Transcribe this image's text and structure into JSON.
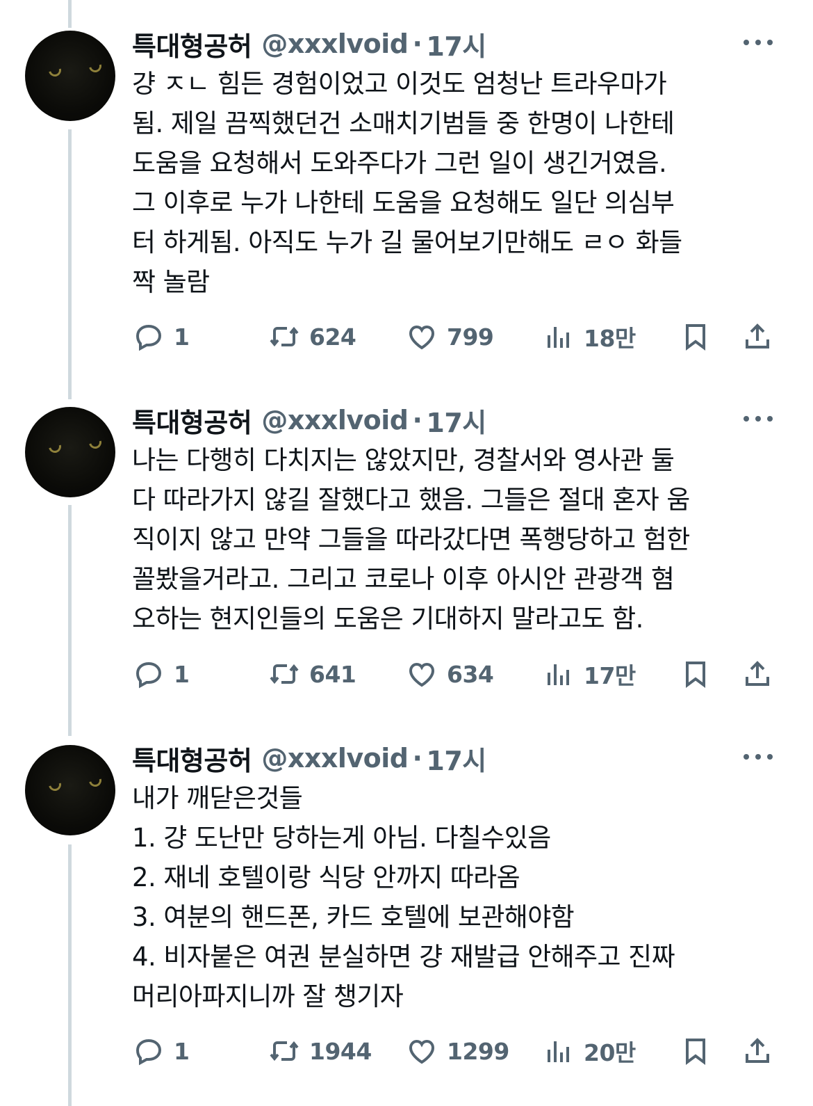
{
  "tweets": [
    {
      "name": "특대형공허",
      "handle": "@xxxlvoid",
      "separator": "·",
      "time": "17시",
      "lines": [
        "걍 ㅈㄴ 힘든 경험이었고 이것도 엄청난 트라우마가",
        "됨. 제일 끔찍했던건 소매치기범들 중 한명이 나한테",
        "도움을 요청해서 도와주다가 그런 일이 생긴거였음.",
        "그 이후로 누가 나한테 도움을 요청해도 일단 의심부",
        "터 하게됨. 아직도 누가 길 물어보기만해도 ㄹㅇ 화들",
        "짝 놀람"
      ],
      "replies": "1",
      "retweets": "624",
      "likes": "799",
      "views": "18만"
    },
    {
      "name": "특대형공허",
      "handle": "@xxxlvoid",
      "separator": "·",
      "time": "17시",
      "lines": [
        "나는 다행히 다치지는 않았지만, 경찰서와 영사관 둘",
        "다 따라가지 않길 잘했다고 했음. 그들은 절대 혼자 움",
        "직이지 않고 만약 그들을 따라갔다면 폭행당하고 험한",
        "꼴봤을거라고. 그리고 코로나 이후 아시안 관광객 혐",
        "오하는 현지인들의 도움은 기대하지 말라고도 함."
      ],
      "replies": "1",
      "retweets": "641",
      "likes": "634",
      "views": "17만"
    },
    {
      "name": "특대형공허",
      "handle": "@xxxlvoid",
      "separator": "·",
      "time": "17시",
      "lines": [
        "내가 깨닫은것들",
        "1. 걍 도난만 당하는게 아님. 다칠수있음",
        "2. 재네 호텔이랑 식당 안까지 따라옴",
        "3. 여분의 핸드폰, 카드 호텔에 보관해야함",
        "4. 비자붙은 여권 분실하면 걍 재발급 안해주고 진짜",
        "머리아파지니까 잘 챙기자"
      ],
      "replies": "1",
      "retweets": "1944",
      "likes": "1299",
      "views": "20만"
    }
  ],
  "icons": {
    "reply": "reply-icon",
    "retweet": "retweet-icon",
    "like": "heart-icon",
    "views": "analytics-icon",
    "bookmark": "bookmark-icon",
    "share": "share-icon",
    "more": "more-icon"
  },
  "colors": {
    "text": "#0f1419",
    "secondary": "#536471",
    "thread_line": "#cfd9de",
    "background": "#ffffff"
  }
}
